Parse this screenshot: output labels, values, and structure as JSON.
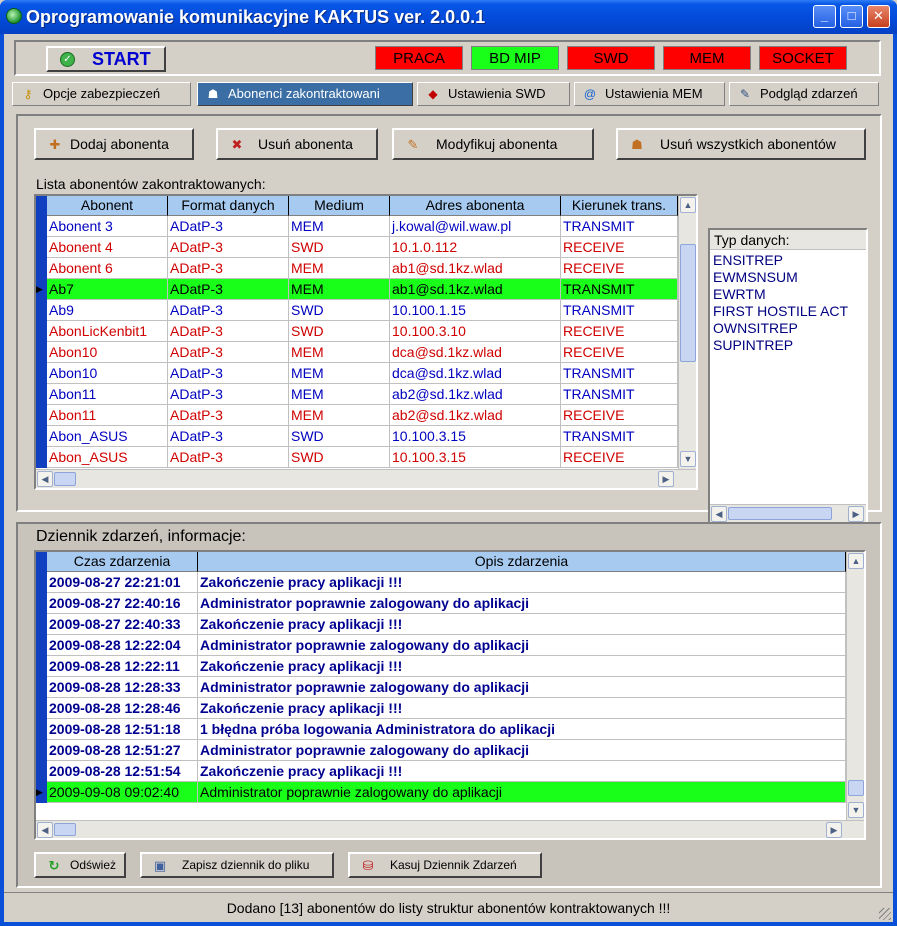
{
  "window": {
    "title": "Oprogramowanie komunikacyjne KAKTUS ver. 2.0.0.1"
  },
  "controls": {
    "minimize": "_",
    "maximize": "□",
    "close": "✕"
  },
  "toolbar": {
    "start_label": "START",
    "indicators": [
      {
        "label": "PRACA",
        "color": "#ff0000"
      },
      {
        "label": "BD MIP",
        "color": "#19ff19"
      },
      {
        "label": "SWD",
        "color": "#ff0000"
      },
      {
        "label": "MEM",
        "color": "#ff0000"
      },
      {
        "label": "SOCKET",
        "color": "#ff0000"
      }
    ]
  },
  "tabs": [
    {
      "label": "Opcje zabezpieczeń",
      "icon": "key-icon"
    },
    {
      "label": "Abonenci zakontraktowani",
      "icon": "users-icon",
      "active": true
    },
    {
      "label": "Ustawienia SWD",
      "icon": "diamond-icon"
    },
    {
      "label": "Ustawienia MEM",
      "icon": "at-icon"
    },
    {
      "label": "Podgląd zdarzeń",
      "icon": "notepad-icon"
    }
  ],
  "actions": {
    "add": "Dodaj abonenta",
    "remove": "Usuń abonenta",
    "modify": "Modyfikuj abonenta",
    "remove_all": "Usuń wszystkich abonentów"
  },
  "subscribers": {
    "caption": "Lista abonentów zakontraktowanych:",
    "columns": [
      "Abonent",
      "Format danych",
      "Medium",
      "Adres abonenta",
      "Kierunek trans."
    ],
    "rows": [
      {
        "cells": [
          "Abonent 3",
          "ADatP-3",
          "MEM",
          "j.kowal@wil.waw.pl",
          "TRANSMIT"
        ],
        "color": "#0000c0"
      },
      {
        "cells": [
          "Abonent 4",
          "ADatP-3",
          "SWD",
          "10.1.0.112",
          "RECEIVE"
        ],
        "color": "#d00000"
      },
      {
        "cells": [
          "Abonent 6",
          "ADatP-3",
          "MEM",
          "ab1@sd.1kz.wlad",
          "RECEIVE"
        ],
        "color": "#d00000"
      },
      {
        "cells": [
          "Ab7",
          "ADatP-3",
          "MEM",
          "ab1@sd.1kz.wlad",
          "TRANSMIT"
        ],
        "color": "#000000",
        "selected": true
      },
      {
        "cells": [
          "Ab9",
          "ADatP-3",
          "SWD",
          "10.100.1.15",
          "TRANSMIT"
        ],
        "color": "#0000c0"
      },
      {
        "cells": [
          "AbonLicKenbit1",
          "ADatP-3",
          "SWD",
          "10.100.3.10",
          "RECEIVE"
        ],
        "color": "#d00000"
      },
      {
        "cells": [
          "Abon10",
          "ADatP-3",
          "MEM",
          "dca@sd.1kz.wlad",
          "RECEIVE"
        ],
        "color": "#d00000"
      },
      {
        "cells": [
          "Abon10",
          "ADatP-3",
          "MEM",
          "dca@sd.1kz.wlad",
          "TRANSMIT"
        ],
        "color": "#0000c0"
      },
      {
        "cells": [
          "Abon11",
          "ADatP-3",
          "MEM",
          "ab2@sd.1kz.wlad",
          "TRANSMIT"
        ],
        "color": "#0000c0"
      },
      {
        "cells": [
          "Abon11",
          "ADatP-3",
          "MEM",
          "ab2@sd.1kz.wlad",
          "RECEIVE"
        ],
        "color": "#d00000"
      },
      {
        "cells": [
          "Abon_ASUS",
          "ADatP-3",
          "SWD",
          "10.100.3.15",
          "TRANSMIT"
        ],
        "color": "#0000c0"
      },
      {
        "cells": [
          "Abon_ASUS",
          "ADatP-3",
          "SWD",
          "10.100.3.15",
          "RECEIVE"
        ],
        "color": "#d00000"
      }
    ]
  },
  "data_types": {
    "header": "Typ danych:",
    "items": [
      "ENSITREP",
      "EWMSNSUM",
      "EWRTM",
      "FIRST HOSTILE ACT",
      "OWNSITREP",
      "SUPINTREP"
    ]
  },
  "log": {
    "caption": "Dziennik zdarzeń, informacje:",
    "columns": [
      "Czas zdarzenia",
      "Opis zdarzenia"
    ],
    "rows": [
      [
        "2009-08-27 22:21:01",
        "Zakończenie pracy aplikacji !!!"
      ],
      [
        "2009-08-27 22:40:16",
        "Administrator poprawnie zalogowany do aplikacji"
      ],
      [
        "2009-08-27 22:40:33",
        "Zakończenie pracy aplikacji !!!"
      ],
      [
        "2009-08-28 12:22:04",
        "Administrator poprawnie zalogowany do aplikacji"
      ],
      [
        "2009-08-28 12:22:11",
        "Zakończenie pracy aplikacji !!!"
      ],
      [
        "2009-08-28 12:28:33",
        "Administrator poprawnie zalogowany do aplikacji"
      ],
      [
        "2009-08-28 12:28:46",
        "Zakończenie pracy aplikacji !!!"
      ],
      [
        "2009-08-28 12:51:18",
        "1 błędna próba logowania Administratora do aplikacji"
      ],
      [
        "2009-08-28 12:51:27",
        "Administrator poprawnie zalogowany do aplikacji"
      ],
      [
        "2009-08-28 12:51:54",
        "Zakończenie pracy aplikacji !!!"
      ],
      [
        "2009-09-08 09:02:40",
        "Administrator poprawnie zalogowany do aplikacji"
      ]
    ],
    "selected_index": 10,
    "refresh": "Odśwież",
    "save": "Zapisz dziennik do pliku",
    "clear": "Kasuj Dziennik Zdarzeń"
  },
  "status_text": "Dodano [13] abonentów do listy struktur abonentów kontraktowanych !!!"
}
